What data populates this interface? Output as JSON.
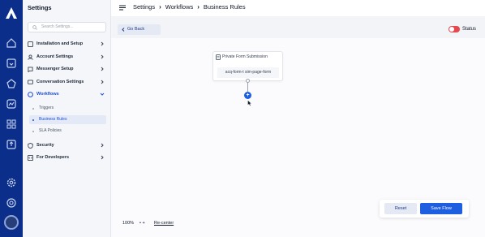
{
  "sidebar": {
    "title": "Settings",
    "search_placeholder": "Search Settings...",
    "items": [
      {
        "label": "Installation and Setup",
        "icon": "wrench-icon"
      },
      {
        "label": "Account Settings",
        "icon": "account-icon"
      },
      {
        "label": "Messenger Setup",
        "icon": "messenger-icon"
      },
      {
        "label": "Conversation Settings",
        "icon": "conversation-icon"
      },
      {
        "label": "Workflows",
        "icon": "workflow-icon",
        "expanded": true
      },
      {
        "label": "Security",
        "icon": "shield-icon"
      },
      {
        "label": "For Developers",
        "icon": "code-icon"
      }
    ],
    "workflow_subitems": [
      {
        "label": "Triggers"
      },
      {
        "label": "Business Rules",
        "active": true
      },
      {
        "label": "SLA Policies"
      }
    ]
  },
  "breadcrumb": [
    "Settings",
    "Workflows",
    "Business Rules"
  ],
  "header": {
    "go_back_label": "Go Back",
    "status_label": "Status",
    "status_enabled": false
  },
  "flow": {
    "node_title": "Private Form Submission",
    "node_value": "acq-form-t sim-page-form",
    "add_step_symbol": "+"
  },
  "footer": {
    "zoom": "100%",
    "zoom_controls": "•  +",
    "recenter_label": "Re-center",
    "reset_label": "Reset",
    "save_label": "Save Flow"
  },
  "colors": {
    "rail": "#0a2e8a",
    "accent": "#1d5fe0",
    "toggle_off": "#e5484d"
  }
}
